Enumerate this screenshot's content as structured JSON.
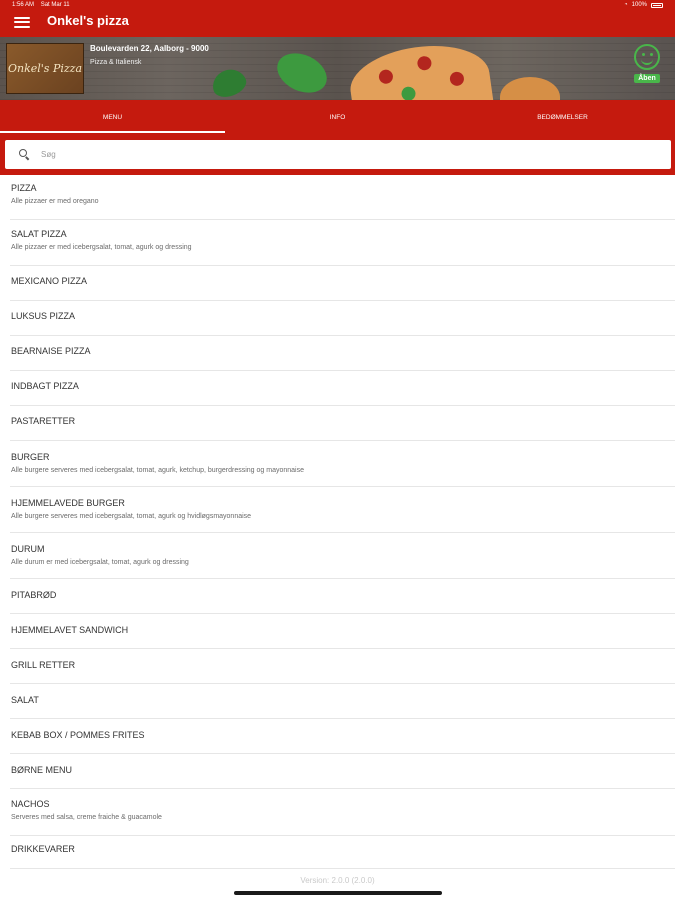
{
  "status_bar": {
    "time": "1:56 AM",
    "date": "Sat Mar 11",
    "battery": "100%"
  },
  "app": {
    "title": "Onkel's pizza"
  },
  "restaurant": {
    "address": "Boulevarden 22, Aalborg - 9000",
    "cuisine": "Pizza & Italiensk",
    "logo_text": "Onkel's Pizza",
    "open_label": "Åben"
  },
  "tabs": [
    {
      "label": "MENU",
      "active": true
    },
    {
      "label": "INFO",
      "active": false
    },
    {
      "label": "BEDØMMELSER",
      "active": false
    }
  ],
  "search": {
    "placeholder": "Søg",
    "value": ""
  },
  "categories": [
    {
      "title": "PIZZA",
      "description": "Alle pizzaer er med oregano"
    },
    {
      "title": "SALAT PIZZA",
      "description": "Alle pizzaer er med icebergsalat, tomat, agurk og dressing"
    },
    {
      "title": "MEXICANO PIZZA",
      "description": ""
    },
    {
      "title": "LUKSUS PIZZA",
      "description": ""
    },
    {
      "title": "BEARNAISE PIZZA",
      "description": ""
    },
    {
      "title": "INDBAGT PIZZA",
      "description": ""
    },
    {
      "title": "PASTARETTER",
      "description": ""
    },
    {
      "title": "BURGER",
      "description": "Alle burgere serveres med icebergsalat, tomat, agurk, ketchup, burgerdressing og mayonnaise"
    },
    {
      "title": "HJEMMELAVEDE BURGER",
      "description": "Alle burgere serveres med icebergsalat, tomat, agurk og hvidløgsmayonnaise"
    },
    {
      "title": "DURUM",
      "description": "Alle durum er med icebergsalat, tomat, agurk og dressing"
    },
    {
      "title": "PITABRØD",
      "description": ""
    },
    {
      "title": "HJEMMELAVET SANDWICH",
      "description": ""
    },
    {
      "title": "GRILL RETTER",
      "description": ""
    },
    {
      "title": "SALAT",
      "description": ""
    },
    {
      "title": "KEBAB BOX / POMMES FRITES",
      "description": ""
    },
    {
      "title": "BØRNE MENU",
      "description": ""
    },
    {
      "title": "NACHOS",
      "description": "Serveres med salsa, creme fraiche & guacamole"
    },
    {
      "title": "DRIKKEVARER",
      "description": ""
    }
  ],
  "footer": {
    "version": "Version: 2.0.0 (2.0.0)"
  },
  "colors": {
    "brand_red": "#c51a0e",
    "open_green": "#49b64a"
  }
}
